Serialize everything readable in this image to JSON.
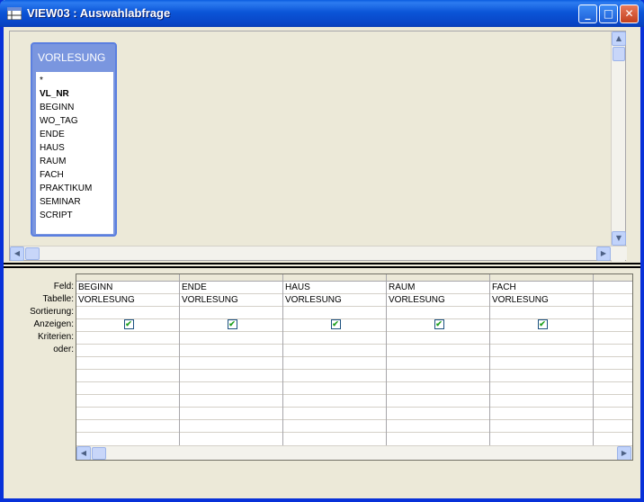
{
  "window": {
    "title": "VIEW03 : Auswahlabfrage",
    "minimize_glyph": "_",
    "maximize_glyph": "□",
    "close_glyph": "✕"
  },
  "table": {
    "name": "VORLESUNG",
    "fields": [
      "*",
      "VL_NR",
      "BEGINN",
      "WO_TAG",
      "ENDE",
      "HAUS",
      "RAUM",
      "FACH",
      "PRAKTIKUM",
      "SEMINAR",
      "SCRIPT"
    ]
  },
  "grid": {
    "row_labels": [
      "Feld:",
      "Tabelle:",
      "Sortierung:",
      "Anzeigen:",
      "Kriterien:",
      "oder:"
    ],
    "columns": [
      {
        "field": "BEGINN",
        "table": "VORLESUNG",
        "sort": "",
        "show": true
      },
      {
        "field": "ENDE",
        "table": "VORLESUNG",
        "sort": "",
        "show": true
      },
      {
        "field": "HAUS",
        "table": "VORLESUNG",
        "sort": "",
        "show": true
      },
      {
        "field": "RAUM",
        "table": "VORLESUNG",
        "sort": "",
        "show": true
      },
      {
        "field": "FACH",
        "table": "VORLESUNG",
        "sort": "",
        "show": true
      }
    ]
  },
  "icons": {
    "scroll_up": "▲",
    "scroll_down": "▼",
    "scroll_left": "◀",
    "scroll_right": "▶",
    "check": "✔"
  }
}
